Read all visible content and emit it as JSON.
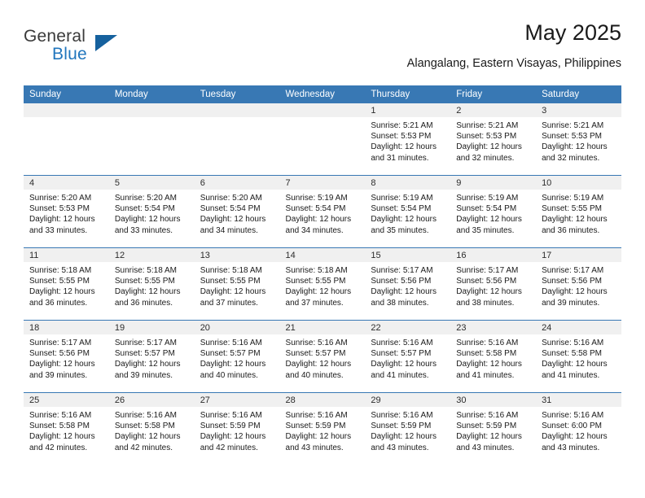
{
  "brand": {
    "name_line1": "General",
    "name_line2": "Blue",
    "accent_color": "#2176bd",
    "triangle_color": "#16619e"
  },
  "header": {
    "title": "May 2025",
    "subtitle": "Alangalang, Eastern Visayas, Philippines"
  },
  "calendar": {
    "header_bg": "#3878b4",
    "daynum_bg": "#f0f0f0",
    "weekday_headers": [
      "Sunday",
      "Monday",
      "Tuesday",
      "Wednesday",
      "Thursday",
      "Friday",
      "Saturday"
    ],
    "weeks": [
      [
        {
          "day": "",
          "sunrise": "",
          "sunset": "",
          "daylight_line1": "",
          "daylight_line2": ""
        },
        {
          "day": "",
          "sunrise": "",
          "sunset": "",
          "daylight_line1": "",
          "daylight_line2": ""
        },
        {
          "day": "",
          "sunrise": "",
          "sunset": "",
          "daylight_line1": "",
          "daylight_line2": ""
        },
        {
          "day": "",
          "sunrise": "",
          "sunset": "",
          "daylight_line1": "",
          "daylight_line2": ""
        },
        {
          "day": "1",
          "sunrise": "Sunrise: 5:21 AM",
          "sunset": "Sunset: 5:53 PM",
          "daylight_line1": "Daylight: 12 hours",
          "daylight_line2": "and 31 minutes."
        },
        {
          "day": "2",
          "sunrise": "Sunrise: 5:21 AM",
          "sunset": "Sunset: 5:53 PM",
          "daylight_line1": "Daylight: 12 hours",
          "daylight_line2": "and 32 minutes."
        },
        {
          "day": "3",
          "sunrise": "Sunrise: 5:21 AM",
          "sunset": "Sunset: 5:53 PM",
          "daylight_line1": "Daylight: 12 hours",
          "daylight_line2": "and 32 minutes."
        }
      ],
      [
        {
          "day": "4",
          "sunrise": "Sunrise: 5:20 AM",
          "sunset": "Sunset: 5:53 PM",
          "daylight_line1": "Daylight: 12 hours",
          "daylight_line2": "and 33 minutes."
        },
        {
          "day": "5",
          "sunrise": "Sunrise: 5:20 AM",
          "sunset": "Sunset: 5:54 PM",
          "daylight_line1": "Daylight: 12 hours",
          "daylight_line2": "and 33 minutes."
        },
        {
          "day": "6",
          "sunrise": "Sunrise: 5:20 AM",
          "sunset": "Sunset: 5:54 PM",
          "daylight_line1": "Daylight: 12 hours",
          "daylight_line2": "and 34 minutes."
        },
        {
          "day": "7",
          "sunrise": "Sunrise: 5:19 AM",
          "sunset": "Sunset: 5:54 PM",
          "daylight_line1": "Daylight: 12 hours",
          "daylight_line2": "and 34 minutes."
        },
        {
          "day": "8",
          "sunrise": "Sunrise: 5:19 AM",
          "sunset": "Sunset: 5:54 PM",
          "daylight_line1": "Daylight: 12 hours",
          "daylight_line2": "and 35 minutes."
        },
        {
          "day": "9",
          "sunrise": "Sunrise: 5:19 AM",
          "sunset": "Sunset: 5:54 PM",
          "daylight_line1": "Daylight: 12 hours",
          "daylight_line2": "and 35 minutes."
        },
        {
          "day": "10",
          "sunrise": "Sunrise: 5:19 AM",
          "sunset": "Sunset: 5:55 PM",
          "daylight_line1": "Daylight: 12 hours",
          "daylight_line2": "and 36 minutes."
        }
      ],
      [
        {
          "day": "11",
          "sunrise": "Sunrise: 5:18 AM",
          "sunset": "Sunset: 5:55 PM",
          "daylight_line1": "Daylight: 12 hours",
          "daylight_line2": "and 36 minutes."
        },
        {
          "day": "12",
          "sunrise": "Sunrise: 5:18 AM",
          "sunset": "Sunset: 5:55 PM",
          "daylight_line1": "Daylight: 12 hours",
          "daylight_line2": "and 36 minutes."
        },
        {
          "day": "13",
          "sunrise": "Sunrise: 5:18 AM",
          "sunset": "Sunset: 5:55 PM",
          "daylight_line1": "Daylight: 12 hours",
          "daylight_line2": "and 37 minutes."
        },
        {
          "day": "14",
          "sunrise": "Sunrise: 5:18 AM",
          "sunset": "Sunset: 5:55 PM",
          "daylight_line1": "Daylight: 12 hours",
          "daylight_line2": "and 37 minutes."
        },
        {
          "day": "15",
          "sunrise": "Sunrise: 5:17 AM",
          "sunset": "Sunset: 5:56 PM",
          "daylight_line1": "Daylight: 12 hours",
          "daylight_line2": "and 38 minutes."
        },
        {
          "day": "16",
          "sunrise": "Sunrise: 5:17 AM",
          "sunset": "Sunset: 5:56 PM",
          "daylight_line1": "Daylight: 12 hours",
          "daylight_line2": "and 38 minutes."
        },
        {
          "day": "17",
          "sunrise": "Sunrise: 5:17 AM",
          "sunset": "Sunset: 5:56 PM",
          "daylight_line1": "Daylight: 12 hours",
          "daylight_line2": "and 39 minutes."
        }
      ],
      [
        {
          "day": "18",
          "sunrise": "Sunrise: 5:17 AM",
          "sunset": "Sunset: 5:56 PM",
          "daylight_line1": "Daylight: 12 hours",
          "daylight_line2": "and 39 minutes."
        },
        {
          "day": "19",
          "sunrise": "Sunrise: 5:17 AM",
          "sunset": "Sunset: 5:57 PM",
          "daylight_line1": "Daylight: 12 hours",
          "daylight_line2": "and 39 minutes."
        },
        {
          "day": "20",
          "sunrise": "Sunrise: 5:16 AM",
          "sunset": "Sunset: 5:57 PM",
          "daylight_line1": "Daylight: 12 hours",
          "daylight_line2": "and 40 minutes."
        },
        {
          "day": "21",
          "sunrise": "Sunrise: 5:16 AM",
          "sunset": "Sunset: 5:57 PM",
          "daylight_line1": "Daylight: 12 hours",
          "daylight_line2": "and 40 minutes."
        },
        {
          "day": "22",
          "sunrise": "Sunrise: 5:16 AM",
          "sunset": "Sunset: 5:57 PM",
          "daylight_line1": "Daylight: 12 hours",
          "daylight_line2": "and 41 minutes."
        },
        {
          "day": "23",
          "sunrise": "Sunrise: 5:16 AM",
          "sunset": "Sunset: 5:58 PM",
          "daylight_line1": "Daylight: 12 hours",
          "daylight_line2": "and 41 minutes."
        },
        {
          "day": "24",
          "sunrise": "Sunrise: 5:16 AM",
          "sunset": "Sunset: 5:58 PM",
          "daylight_line1": "Daylight: 12 hours",
          "daylight_line2": "and 41 minutes."
        }
      ],
      [
        {
          "day": "25",
          "sunrise": "Sunrise: 5:16 AM",
          "sunset": "Sunset: 5:58 PM",
          "daylight_line1": "Daylight: 12 hours",
          "daylight_line2": "and 42 minutes."
        },
        {
          "day": "26",
          "sunrise": "Sunrise: 5:16 AM",
          "sunset": "Sunset: 5:58 PM",
          "daylight_line1": "Daylight: 12 hours",
          "daylight_line2": "and 42 minutes."
        },
        {
          "day": "27",
          "sunrise": "Sunrise: 5:16 AM",
          "sunset": "Sunset: 5:59 PM",
          "daylight_line1": "Daylight: 12 hours",
          "daylight_line2": "and 42 minutes."
        },
        {
          "day": "28",
          "sunrise": "Sunrise: 5:16 AM",
          "sunset": "Sunset: 5:59 PM",
          "daylight_line1": "Daylight: 12 hours",
          "daylight_line2": "and 43 minutes."
        },
        {
          "day": "29",
          "sunrise": "Sunrise: 5:16 AM",
          "sunset": "Sunset: 5:59 PM",
          "daylight_line1": "Daylight: 12 hours",
          "daylight_line2": "and 43 minutes."
        },
        {
          "day": "30",
          "sunrise": "Sunrise: 5:16 AM",
          "sunset": "Sunset: 5:59 PM",
          "daylight_line1": "Daylight: 12 hours",
          "daylight_line2": "and 43 minutes."
        },
        {
          "day": "31",
          "sunrise": "Sunrise: 5:16 AM",
          "sunset": "Sunset: 6:00 PM",
          "daylight_line1": "Daylight: 12 hours",
          "daylight_line2": "and 43 minutes."
        }
      ]
    ]
  }
}
